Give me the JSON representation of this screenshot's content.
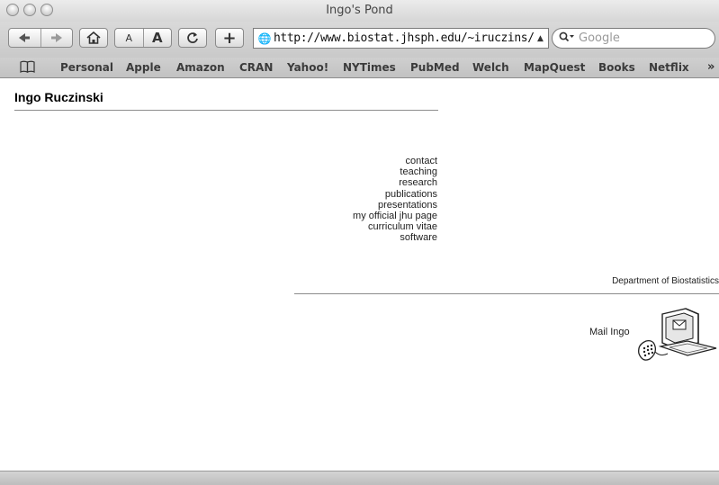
{
  "window": {
    "title": "Ingo's Pond"
  },
  "toolbar": {
    "back_icon": "back-arrow-icon",
    "forward_icon": "forward-arrow-icon",
    "home_icon": "home-icon",
    "text_smaller_label": "A",
    "text_larger_label": "A",
    "reload_icon": "reload-icon",
    "add_bookmark_label": "+",
    "url": "http://www.biostat.jhsph.edu/~iruczins/",
    "search_placeholder": "Google"
  },
  "bookmarks": {
    "items": [
      "Personal",
      "Apple",
      "Amazon",
      "CRAN",
      "Yahoo!",
      "NYTimes",
      "PubMed",
      "Welch",
      "MapQuest",
      "Books",
      "Netflix"
    ],
    "more_label": "»"
  },
  "page": {
    "heading": "Ingo Ruczinski",
    "nav": [
      "contact",
      "teaching",
      "research",
      "publications",
      "presentations",
      "my official jhu page",
      "curriculum vitae",
      "software"
    ],
    "department": "Department of Biostatistics",
    "mail_label": "Mail Ingo",
    "mail_icon": "computer-mail-icon"
  },
  "colors": {
    "link_text": "#222222",
    "rule": "#8c8c8c"
  }
}
